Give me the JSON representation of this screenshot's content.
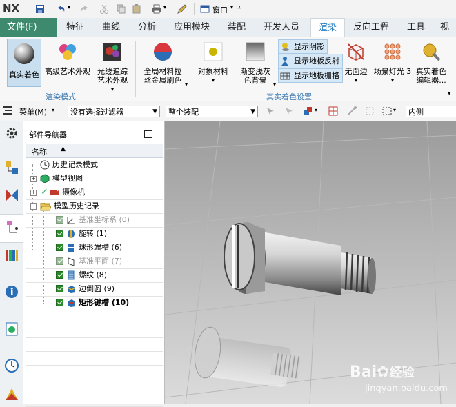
{
  "titlebar": {
    "logo": "NX",
    "window_menu": "窗口"
  },
  "menubar": {
    "tabs": [
      {
        "label": "文件(F)"
      },
      {
        "label": "特征"
      },
      {
        "label": "曲线"
      },
      {
        "label": "分析"
      },
      {
        "label": "应用模块"
      },
      {
        "label": "装配"
      },
      {
        "label": "开发人员"
      },
      {
        "label": "渲染"
      },
      {
        "label": "反向工程"
      },
      {
        "label": "工具"
      },
      {
        "label": "视图"
      }
    ]
  },
  "ribbon": {
    "real_shading": "真实着色",
    "advanced_art": "高级艺术外观",
    "raytrace_1": "光线追踪",
    "raytrace_2": "艺术外观",
    "group_render_mode": "渲染模式",
    "global_mat_1": "全局材料拉",
    "global_mat_2": "丝金属刷色",
    "object_material": "对象材料",
    "gradient_1": "渐变浅灰",
    "gradient_2": "色背景",
    "show_shadow": "显示阴影",
    "show_floor_reflect": "显示地板反射",
    "show_floor_grid": "显示地板栅格",
    "no_side": "无面边",
    "scene_light": "场景灯光 3",
    "editor_1": "真实着色",
    "editor_2": "编辑器...",
    "group_real_settings": "真实着色设置"
  },
  "toolbar2": {
    "menu_label": "菜单(M)",
    "filter": "没有选择过滤器",
    "assembly": "整个装配",
    "inside": "内侧"
  },
  "navigator": {
    "title": "部件导航器",
    "col_name": "名称",
    "rows": [
      {
        "label": "历史记录模式"
      },
      {
        "label": "模型视图"
      },
      {
        "label": "摄像机"
      },
      {
        "label": "模型历史记录"
      },
      {
        "label": "基准坐标系 (0)"
      },
      {
        "label": "旋转 (1)"
      },
      {
        "label": "球形端槽 (6)"
      },
      {
        "label": "基准平面 (7)"
      },
      {
        "label": "螺纹 (8)"
      },
      {
        "label": "边倒圆 (9)"
      },
      {
        "label": "矩形键槽 (10)"
      }
    ]
  },
  "watermark": {
    "brand": "Bai",
    "brand_cn": "经验",
    "url": "jingyan.baidu.com"
  },
  "colors": {
    "file_tab": "#3d8a6e",
    "active_tab_text": "#2a7fc0",
    "group_label": "#3a78b0"
  }
}
